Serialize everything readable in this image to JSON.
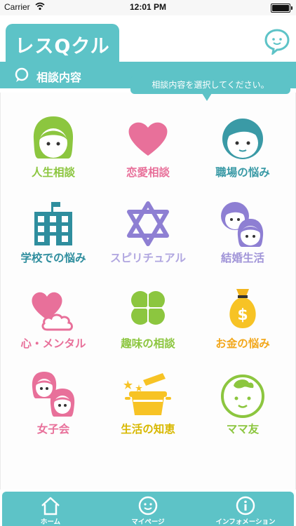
{
  "status_bar": {
    "carrier": "Carrier",
    "time": "12:01 PM"
  },
  "header": {
    "logo": "レスQクル",
    "section_title": "相談内容",
    "tooltip": "相談内容を選択してください。"
  },
  "categories": [
    {
      "label": "人生相談",
      "icon": "girl-face-icon",
      "color": "#8cc63f"
    },
    {
      "label": "恋愛相談",
      "icon": "heart-icon",
      "color": "#e8709a"
    },
    {
      "label": "職場の悩み",
      "icon": "boy-face-icon",
      "color": "#3a9aa6"
    },
    {
      "label": "学校での悩み",
      "icon": "school-building-icon",
      "color": "#2f8e9e"
    },
    {
      "label": "スピリチュアル",
      "icon": "hexagram-icon",
      "color": "#8e7fd3"
    },
    {
      "label": "結婚生活",
      "icon": "couple-icon",
      "color": "#8e7fd3"
    },
    {
      "label": "心・メンタル",
      "icon": "heart-cloud-icon",
      "color": "#e8709a"
    },
    {
      "label": "趣味の相談",
      "icon": "clover-icon",
      "color": "#8cc63f"
    },
    {
      "label": "お金の悩み",
      "icon": "money-bag-icon",
      "color": "#f2a81d"
    },
    {
      "label": "女子会",
      "icon": "two-girls-icon",
      "color": "#e8709a"
    },
    {
      "label": "生活の知恵",
      "icon": "cooking-pot-icon",
      "color": "#d8b800"
    },
    {
      "label": "ママ友",
      "icon": "baby-face-icon",
      "color": "#8cc63f"
    }
  ],
  "tabs": [
    {
      "label": "ホーム",
      "icon": "home-icon"
    },
    {
      "label": "マイページ",
      "icon": "smiley-icon"
    },
    {
      "label": "インフォメーション",
      "icon": "info-icon"
    }
  ],
  "colors": {
    "accent": "#5dc3c7"
  }
}
